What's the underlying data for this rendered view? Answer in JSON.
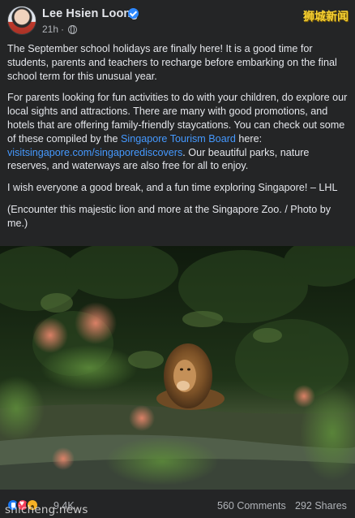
{
  "header": {
    "author": "Lee Hsien Loong",
    "time": "21h",
    "privacy_icon": "globe-icon",
    "verified_icon": "verified-badge-icon",
    "watermark": "狮城新闻"
  },
  "post": {
    "p1": "The September school holidays are finally here! It is a good time for students, parents and teachers to recharge before embarking on the final school term for this unusual year.",
    "p2_before": "For parents looking for fun activities to do with your children, do explore our local sights and attractions. There are many with good promotions, and hotels that are offering family-friendly staycations. You can check out some of these compiled by the ",
    "p2_link": "Singapore Tourism Board",
    "p2_mid": " here: ",
    "p2_url": "visitsingapore.com/singaporediscovers",
    "p2_after": ". Our beautiful parks, nature reserves, and waterways are also free for all to enjoy.",
    "p3": "I wish everyone a good break, and a fun time exploring Singapore! – LHL",
    "p4": "(Encounter this majestic lion and more at the Singapore Zoo. / Photo by me.)"
  },
  "photo": {
    "subject": "lion-photo"
  },
  "footer": {
    "reaction_icons": [
      "like-icon",
      "love-icon",
      "wow-icon"
    ],
    "reaction_count": "9.4K",
    "comments": "560 Comments",
    "shares": "292 Shares",
    "watermark": "shicheng.news"
  },
  "colors": {
    "background": "#242526",
    "text": "#e4e6eb",
    "muted": "#b0b3b8",
    "link": "#4599ff",
    "verified": "#2d88ff"
  }
}
